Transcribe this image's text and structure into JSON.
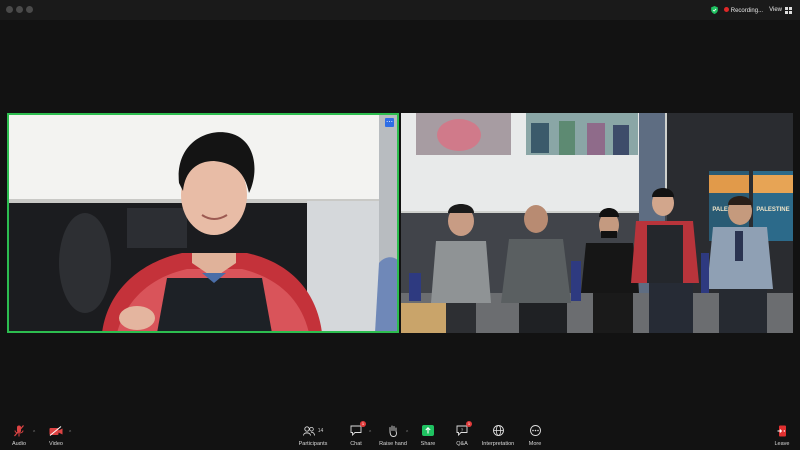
{
  "titlebar": {
    "recording_label": "Recording...",
    "view_label": "View"
  },
  "toolbar": {
    "audio_label": "Audio",
    "video_label": "Video",
    "participants_label": "Participants",
    "participants_count": "14",
    "chat_label": "Chat",
    "chat_badge": "1",
    "raise_hand_label": "Raise hand",
    "share_label": "Share",
    "qa_label": "Q&A",
    "qa_badge": "1",
    "interpretation_label": "Interpretation",
    "more_label": "More",
    "leave_label": "Leave"
  },
  "poster": {
    "heading": "PALESTINE",
    "subheading": "PALESTINE"
  },
  "colors": {
    "active_speaker_border": "#2dbd4f",
    "share_green": "#1fc261",
    "badge_red": "#e23b3b",
    "leave_red": "#e03030"
  }
}
